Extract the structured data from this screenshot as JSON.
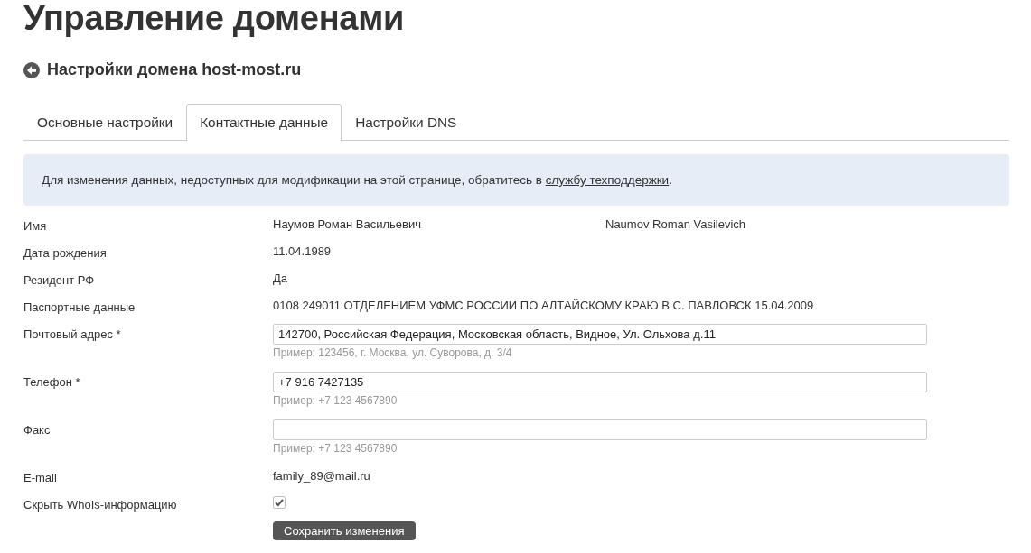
{
  "page": {
    "title": "Управление доменами"
  },
  "subheader": {
    "title": "Настройки домена host-most.ru"
  },
  "tabs": [
    {
      "label": "Основные настройки",
      "selected": false
    },
    {
      "label": "Контактные данные",
      "selected": true
    },
    {
      "label": "Настройки DNS",
      "selected": false
    }
  ],
  "notice": {
    "text": "Для изменения данных, недоступных для модификации на этой странице, обратитесь в ",
    "link": "службу техподдержки",
    "suffix": "."
  },
  "fields": [
    {
      "kind": "text",
      "label": "Имя",
      "values": [
        "Наумов Роман Васильевич",
        "Naumov Roman Vasilevich"
      ]
    },
    {
      "kind": "text",
      "label": "Дата рождения",
      "values": [
        "11.04.1989"
      ]
    },
    {
      "kind": "text",
      "label": "Резидент РФ",
      "values": [
        "Да"
      ]
    },
    {
      "kind": "text",
      "label": "Паспортные данные",
      "values": [
        "0108 249011 ОТДЕЛЕНИЕМ УФМС РОССИИ ПО АЛТАЙСКОМУ КРАЮ В С. ПАВЛОВСК 15.04.2009"
      ]
    },
    {
      "kind": "input",
      "label": "Почтовый адрес *",
      "value": "142700, Российская Федерация, Московская область, Видное, Ул. Ольхова д.11",
      "hint": "Пример: 123456, г. Москва, ул. Суворова, д. 3/4"
    },
    {
      "kind": "input",
      "label": "Телефон *",
      "value": "+7 916 7427135",
      "hint": "Пример: +7 123 4567890"
    },
    {
      "kind": "input",
      "label": "Факс",
      "hint": "Пример: +7 123 4567890"
    },
    {
      "kind": "text",
      "label": "E-mail",
      "values": [
        "family_89@mail.ru"
      ]
    },
    {
      "kind": "checkbox",
      "label": "Скрыть WhoIs-информацию",
      "checked": true
    }
  ],
  "submit": {
    "label": "Сохранить изменения"
  }
}
